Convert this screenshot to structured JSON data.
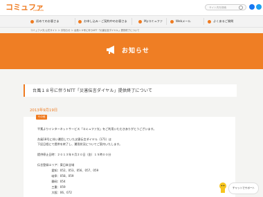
{
  "header": {
    "logo_text": "コミュファ",
    "logo_sub": "commufa",
    "search_placeholder": "サイト内を検索"
  },
  "nav": {
    "items": [
      {
        "label": "初めてのお客さま"
      },
      {
        "label": "お申し込み・ご契約中のお客さま"
      },
      {
        "label": "Myコミュファ"
      },
      {
        "label": "Webメール"
      },
      {
        "label": "よくあるご質問"
      }
    ]
  },
  "breadcrumb": "コミュファ光 公式サイト ＞ お知らせ ＞ 台風１８号に伴うNTT「災害伝言ダイヤル」提供終了について",
  "banner": {
    "title": "お知らせ"
  },
  "article": {
    "title": "台風１８号に伴うNTT「災害伝言ダイヤル」提供終了について",
    "date": "2013年9月19日",
    "category": "その他",
    "lines": [
      "平素よりインターネットサービス「コミュファ光」をご利用いただきありがとうございます。",
      "",
      "台風18号に伴い運用していた災害伝言ダイヤル（171）は",
      "下記日程にて提供を終了し、運用状況についてご案内いたします。",
      "",
      "提供停止日時：２０１３年９月２０日（金）１５時００分",
      "",
      "伝言登録エリア：東日本全域",
      "　　　　　愛知：052、053、056、057、059",
      "　　　　　岐阜：058、059",
      "　　　　　静岡：054",
      "　　　　　三重：059",
      "　　　　　大阪：06、072"
    ]
  },
  "chat": {
    "label": "チャットでサポート"
  },
  "colors": {
    "accent": "#ef7a1f"
  }
}
